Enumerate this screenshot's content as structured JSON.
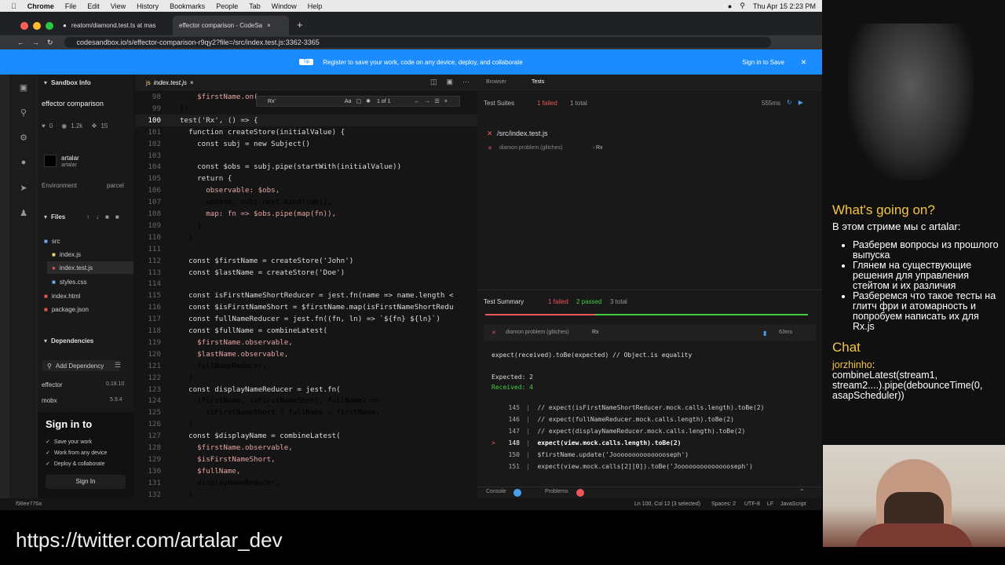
{
  "menubar": {
    "app": "Chrome",
    "items": [
      "File",
      "Edit",
      "View",
      "History",
      "Bookmarks",
      "People",
      "Tab",
      "Window",
      "Help"
    ],
    "clock": "Thu Apr 15  2:23 PM"
  },
  "browser": {
    "tabs": [
      {
        "title": "reatom/diamond.test.ts at mas"
      },
      {
        "title": "effector comparison - CodeSa"
      }
    ],
    "url": "codesandbox.io/s/effector-comparison-r9qy2?file=/src/index.test.js:3362-3365"
  },
  "banner": {
    "pill": "Tip",
    "text": "Register to save your work, code on any device, deploy, and collaborate",
    "signin": "Sign in to Save"
  },
  "sidebar": {
    "title": "Sandbox Info",
    "sandbox": "effector comparison",
    "stats": [
      "0",
      "1.2k",
      "15"
    ],
    "user": "artalar",
    "user_sub": "artalar",
    "env_label": "Environment",
    "env_value": "parcel",
    "files_label": "Files",
    "files": [
      {
        "name": "src",
        "icon": "folder"
      },
      {
        "name": "index.js",
        "icon": "js"
      },
      {
        "name": "index.test.js",
        "icon": "test"
      },
      {
        "name": "styles.css",
        "icon": "css"
      },
      {
        "name": "index.html",
        "icon": "html"
      },
      {
        "name": "package.json",
        "icon": "json"
      }
    ],
    "deps_label": "Dependencies",
    "add_dep": "Add Dependency",
    "deps": [
      {
        "name": "effector",
        "ver": "0.18.10"
      },
      {
        "name": "mobx",
        "ver": "5.9.4"
      }
    ],
    "signin_title": "Sign in to",
    "signin_items": [
      "Save your work",
      "Work from any device",
      "Deploy & collaborate"
    ],
    "signin_btn": "Sign In"
  },
  "editor": {
    "tab": "index.test.js",
    "find": {
      "query": "Rx'",
      "count": "1 of 1",
      "opts": "Aa"
    },
    "lines": [
      {
        "n": "98",
        "t": "    $firstName.on("
      },
      {
        "n": "99",
        "t": "})"
      },
      {
        "n": "100",
        "t": "test('Rx', () => {"
      },
      {
        "n": "101",
        "t": "  function createStore(initialValue) {"
      },
      {
        "n": "102",
        "t": "    const subj = new Subject()"
      },
      {
        "n": "103",
        "t": ""
      },
      {
        "n": "104",
        "t": "    const $obs = subj.pipe(startWith(initialValue))"
      },
      {
        "n": "105",
        "t": "    return {"
      },
      {
        "n": "106",
        "t": "      observable: $obs,"
      },
      {
        "n": "107",
        "t": "      update: subj.next.bind(subj),"
      },
      {
        "n": "108",
        "t": "      map: fn => $obs.pipe(map(fn)),"
      },
      {
        "n": "109",
        "t": "    }"
      },
      {
        "n": "110",
        "t": "  }"
      },
      {
        "n": "111",
        "t": ""
      },
      {
        "n": "112",
        "t": "  const $firstName = createStore('John')"
      },
      {
        "n": "113",
        "t": "  const $lastName = createStore('Doe')"
      },
      {
        "n": "114",
        "t": ""
      },
      {
        "n": "115",
        "t": "  const isFirstNameShortReducer = jest.fn(name => name.length <"
      },
      {
        "n": "116",
        "t": "  const $isFirstNameShort = $firstName.map(isFirstNameShortRedu"
      },
      {
        "n": "117",
        "t": "  const fullNameReducer = jest.fn((fn, ln) => `${fn} ${ln}`)"
      },
      {
        "n": "118",
        "t": "  const $fullName = combineLatest("
      },
      {
        "n": "119",
        "t": "    $firstName.observable,"
      },
      {
        "n": "120",
        "t": "    $lastName.observable,"
      },
      {
        "n": "121",
        "t": "    fullNameReducer,"
      },
      {
        "n": "122",
        "t": "  )"
      },
      {
        "n": "123",
        "t": "  const displayNameReducer = jest.fn("
      },
      {
        "n": "124",
        "t": "    (firstName, isFirstNameShort, fullName) =>"
      },
      {
        "n": "125",
        "t": "      isFirstNameShort ? fullName : firstName,"
      },
      {
        "n": "126",
        "t": "  )"
      },
      {
        "n": "127",
        "t": "  const $displayName = combineLatest("
      },
      {
        "n": "128",
        "t": "    $firstName.observable,"
      },
      {
        "n": "129",
        "t": "    $isFirstNameShort,"
      },
      {
        "n": "130",
        "t": "    $fullName,"
      },
      {
        "n": "131",
        "t": "    displayNameReducer,"
      },
      {
        "n": "132",
        "t": "  )"
      }
    ]
  },
  "tests": {
    "tab_browser": "Browser",
    "tab_tests": "Tests",
    "suites_label": "Test Suites",
    "failed": "1 failed",
    "total": "1 total",
    "time": "555ms",
    "file": "/src/index.test.js",
    "case": "diamon problem (glitches)",
    "case_sub": "Rx",
    "summary_label": "Test Summary",
    "sum_failed": "1 failed",
    "sum_passed": "2 passed",
    "sum_total": "3 total",
    "fail_case": "diamon problem (glitches)",
    "fail_sub": "Rx",
    "fail_time": "63ms",
    "expect_line": "expect(received).toBe(expected) // Object.is equality",
    "expected": "Expected: 2",
    "received": "Received: 4",
    "code": [
      {
        "mark": "",
        "n": "145",
        "t": "// expect(isFirstNameShortReducer.mock.calls.length).toBe(2)"
      },
      {
        "mark": "",
        "n": "146",
        "t": "// expect(fullNameReducer.mock.calls.length).toBe(2)"
      },
      {
        "mark": "",
        "n": "147",
        "t": "// expect(displayNameReducer.mock.calls.length).toBe(2)"
      },
      {
        "mark": ">",
        "n": "148",
        "t": "expect(view.mock.calls.length).toBe(2)"
      },
      {
        "mark": "",
        "n": "150",
        "t": "$firstName.update('Jooooooooooooooseph')"
      },
      {
        "mark": "",
        "n": "151",
        "t": "expect(view.mock.calls[2][0]).toBe('Jooooooooooooooseph')"
      }
    ],
    "console": "Console",
    "problems": "Problems"
  },
  "status": {
    "hash": "f98ee776a",
    "pos": "Ln 100, Col 12 (3 selected)",
    "spaces": "Spaces: 2",
    "enc": "UTF-8",
    "eol": "LF",
    "lang": "JavaScript"
  },
  "overlay": {
    "title": "What's going on?",
    "intro": "В этом стриме мы с artalar:",
    "bullets": [
      "Разберем вопросы из прошлого выпуска",
      "Глянем на существующие решения для управления стейтом и их различия",
      "Разберемся что такое тесты на глитч фри и атомарность  и попробуем написать их для Rx.js"
    ],
    "chat_title": "Chat",
    "chat_user": "jorzhinho",
    "chat_text": "combineLatest(stream1, stream2....).pipe(debounceTime(0, asapScheduler))"
  },
  "twitter": "https://twitter.com/artalar_dev"
}
